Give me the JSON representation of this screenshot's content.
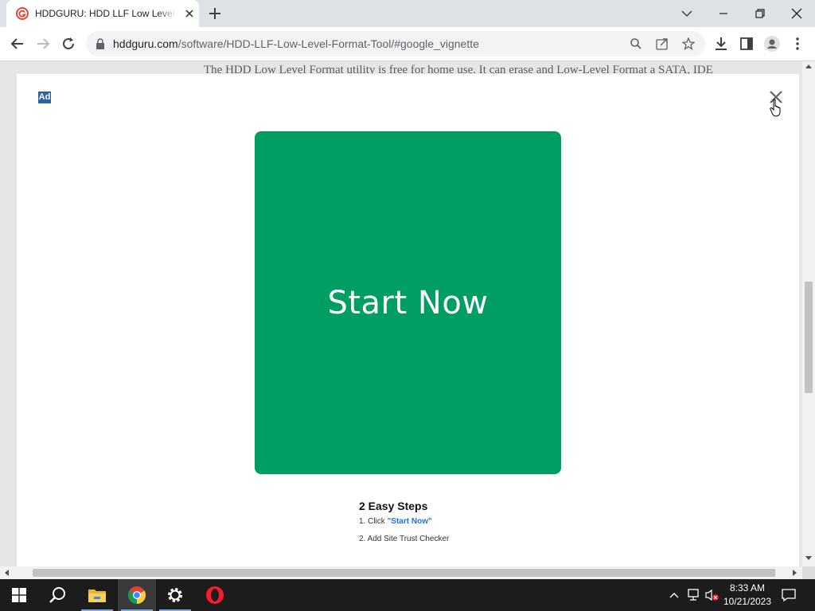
{
  "browser": {
    "tab_title": "HDDGURU: HDD LLF Low Level Format Tool",
    "url_host": "hddguru.com",
    "url_path": "/software/HDD-LLF-Low-Level-Format-Tool/#google_vignette"
  },
  "page": {
    "background_text": "The HDD Low Level Format utility is free for home use. It can erase and Low-Level Format a SATA, IDE"
  },
  "ad": {
    "badge": "Ad",
    "cta_label": "Start Now",
    "cta_color": "#009e63",
    "steps_title": "2 Easy Steps",
    "step1_prefix": "1. Click ",
    "step1_link": "\"Start Now\"",
    "step2": "2. Add Site Trust Checker"
  },
  "taskbar": {
    "time": "8:33 AM",
    "date": "10/21/2023",
    "apps": [
      "start-icon",
      "search-icon",
      "file-explorer-icon",
      "chrome-icon",
      "settings-icon",
      "opera-icon"
    ]
  }
}
